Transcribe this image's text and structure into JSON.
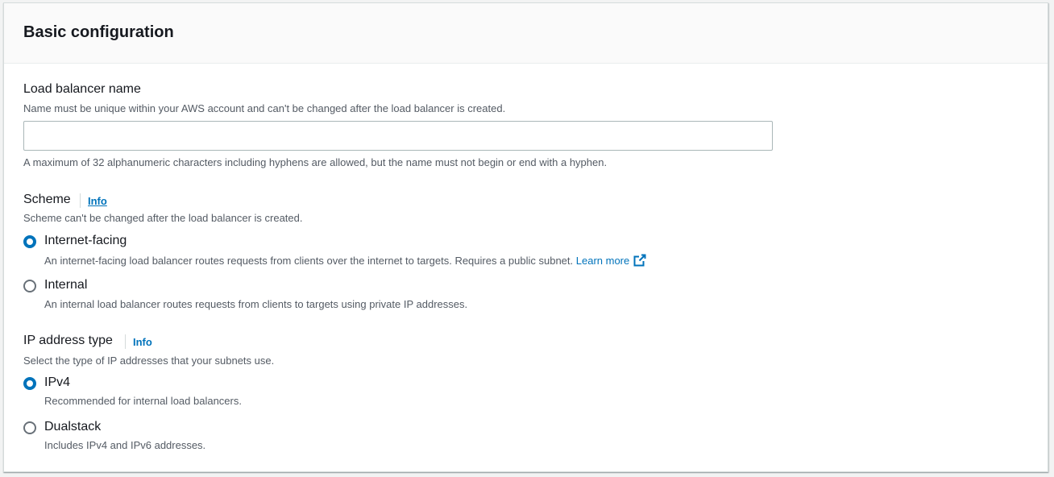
{
  "panel": {
    "title": "Basic configuration"
  },
  "lb_name": {
    "label": "Load balancer name",
    "description": "Name must be unique within your AWS account and can't be changed after the load balancer is created.",
    "value": "",
    "constraint": "A maximum of 32 alphanumeric characters including hyphens are allowed, but the name must not begin or end with a hyphen."
  },
  "scheme": {
    "label": "Scheme",
    "info": "Info",
    "description": "Scheme can't be changed after the load balancer is created.",
    "selected": "Internet-facing",
    "options": [
      {
        "label": "Internet-facing",
        "description": "An internet-facing load balancer routes requests from clients over the internet to targets. Requires a public subnet.",
        "link": "Learn more",
        "link_icon": "external-link-icon",
        "checked": true
      },
      {
        "label": "Internal",
        "description": "An internal load balancer routes requests from clients to targets using private IP addresses.",
        "checked": false
      }
    ]
  },
  "ip_type": {
    "label": "IP address type",
    "info": "Info",
    "description": "Select the type of IP addresses that your subnets use.",
    "selected": "IPv4",
    "options": [
      {
        "label": "IPv4",
        "description": "Recommended for internal load balancers.",
        "checked": true
      },
      {
        "label": "Dualstack",
        "description": "Includes IPv4 and IPv6 addresses.",
        "checked": false
      }
    ]
  },
  "colors": {
    "link": "#0073bb",
    "radio_selected": "#0073bb",
    "text_primary": "#16191f",
    "text_secondary": "#545b64"
  }
}
